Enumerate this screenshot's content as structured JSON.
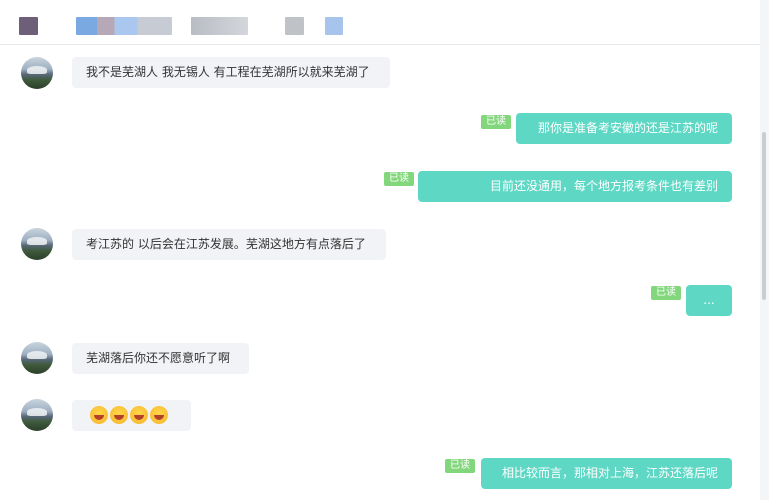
{
  "colors": {
    "sent_bubble": "#5ed8c4",
    "received_bubble": "#f1f3f6",
    "read_badge": "#82d67c",
    "header_blocks": [
      "#6e5f78",
      "#7aa8e0",
      "#b7a8b8",
      "#a9c7ef",
      "#b8bcc4",
      "#d4d6da",
      "#bfc3c8",
      "#a7c5ec"
    ]
  },
  "header": {
    "note": ""
  },
  "messages": [
    {
      "side": "received",
      "text": "我不是芜湖人 我无锡人 有工程在芜湖所以就来芜湖了"
    },
    {
      "side": "sent",
      "text": "那你是准备考安徽的还是江苏的呢",
      "read_label": "已读"
    },
    {
      "side": "sent",
      "text": "目前还没通用，每个地方报考条件也有差别",
      "read_label": "已读"
    },
    {
      "side": "received",
      "text": "考江苏的 以后会在江苏发展。芜湖这地方有点落后了"
    },
    {
      "side": "sent",
      "text": "...",
      "read_label": "已读"
    },
    {
      "side": "received",
      "text": "芜湖落后你还不愿意听了啊"
    },
    {
      "side": "received",
      "text": "",
      "emoji": [
        "grinning-face-icon",
        "grinning-face-icon",
        "grinning-face-icon",
        "grinning-face-icon"
      ]
    },
    {
      "side": "sent",
      "text": "相比较而言，那相对上海，江苏还落后呢",
      "read_label": "已读"
    }
  ]
}
